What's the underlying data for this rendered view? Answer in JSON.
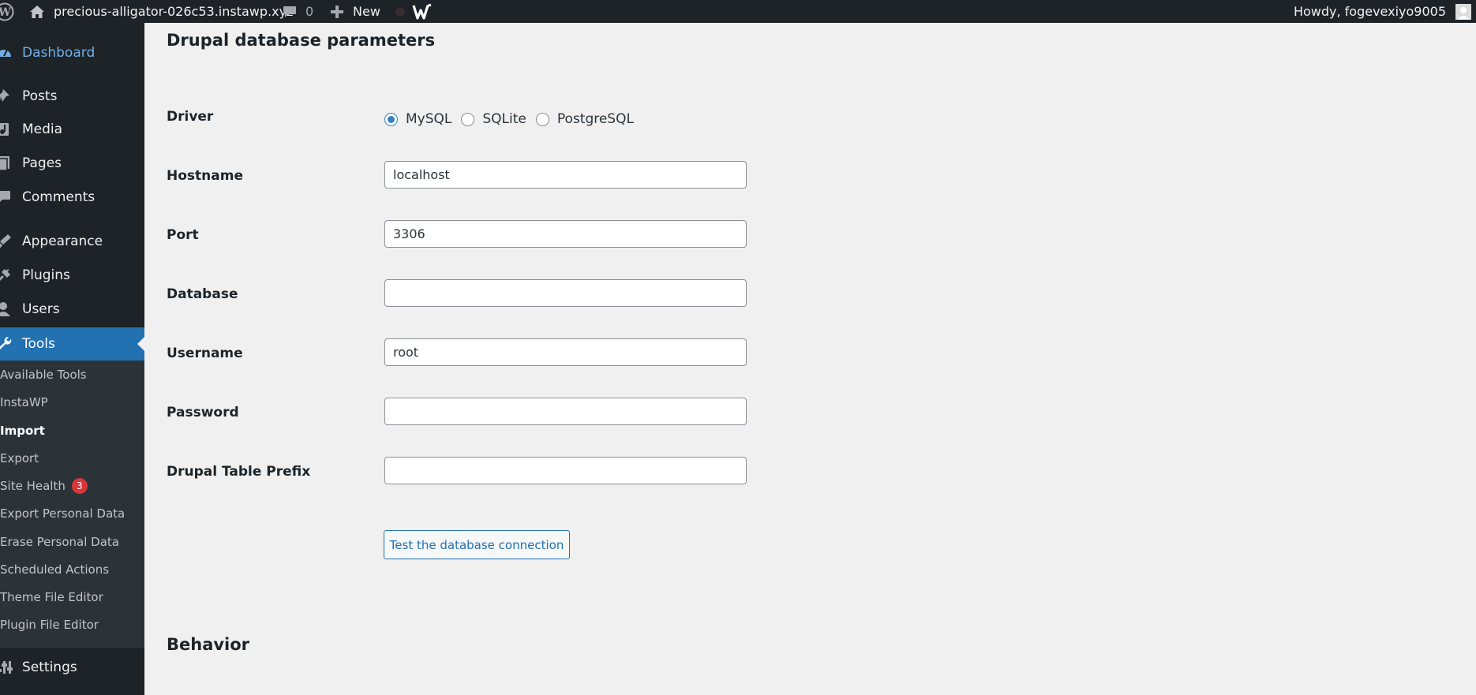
{
  "adminbar": {
    "site_name": "precious-alligator-026c53.instawp.xyz",
    "comments_count": "0",
    "new_label": "New",
    "greeting": "Howdy, fogevexiyo9005"
  },
  "sidebar": {
    "items": [
      {
        "label": "Dashboard",
        "icon": "dashboard-icon"
      },
      {
        "label": "Posts",
        "icon": "pin-icon"
      },
      {
        "label": "Media",
        "icon": "media-icon"
      },
      {
        "label": "Pages",
        "icon": "page-icon"
      },
      {
        "label": "Comments",
        "icon": "comment-icon"
      },
      {
        "label": "Appearance",
        "icon": "brush-icon"
      },
      {
        "label": "Plugins",
        "icon": "plug-icon"
      },
      {
        "label": "Users",
        "icon": "user-icon"
      },
      {
        "label": "Tools",
        "icon": "wrench-icon"
      },
      {
        "label": "Settings",
        "icon": "sliders-icon"
      }
    ],
    "submenu": [
      {
        "label": "Available Tools"
      },
      {
        "label": "InstaWP"
      },
      {
        "label": "Import"
      },
      {
        "label": "Export"
      },
      {
        "label": "Site Health",
        "badge": "3"
      },
      {
        "label": "Export Personal Data"
      },
      {
        "label": "Erase Personal Data"
      },
      {
        "label": "Scheduled Actions"
      },
      {
        "label": "Theme File Editor"
      },
      {
        "label": "Plugin File Editor"
      }
    ]
  },
  "main": {
    "section_title": "Drupal database parameters",
    "driver": {
      "label": "Driver",
      "options": [
        "MySQL",
        "SQLite",
        "PostgreSQL"
      ],
      "selected": "MySQL"
    },
    "fields": {
      "hostname": {
        "label": "Hostname",
        "value": "localhost"
      },
      "port": {
        "label": "Port",
        "value": "3306"
      },
      "database": {
        "label": "Database",
        "value": ""
      },
      "username": {
        "label": "Username",
        "value": "root"
      },
      "password": {
        "label": "Password",
        "value": ""
      },
      "prefix": {
        "label": "Drupal Table Prefix",
        "value": ""
      }
    },
    "test_button": "Test the database connection",
    "behavior_title": "Behavior"
  },
  "colors": {
    "adminbar_bg": "#1d2327",
    "menu_current_bg": "#2271b1",
    "submenu_bg": "#2c3338",
    "accent": "#2271b1",
    "badge": "#d63638"
  }
}
